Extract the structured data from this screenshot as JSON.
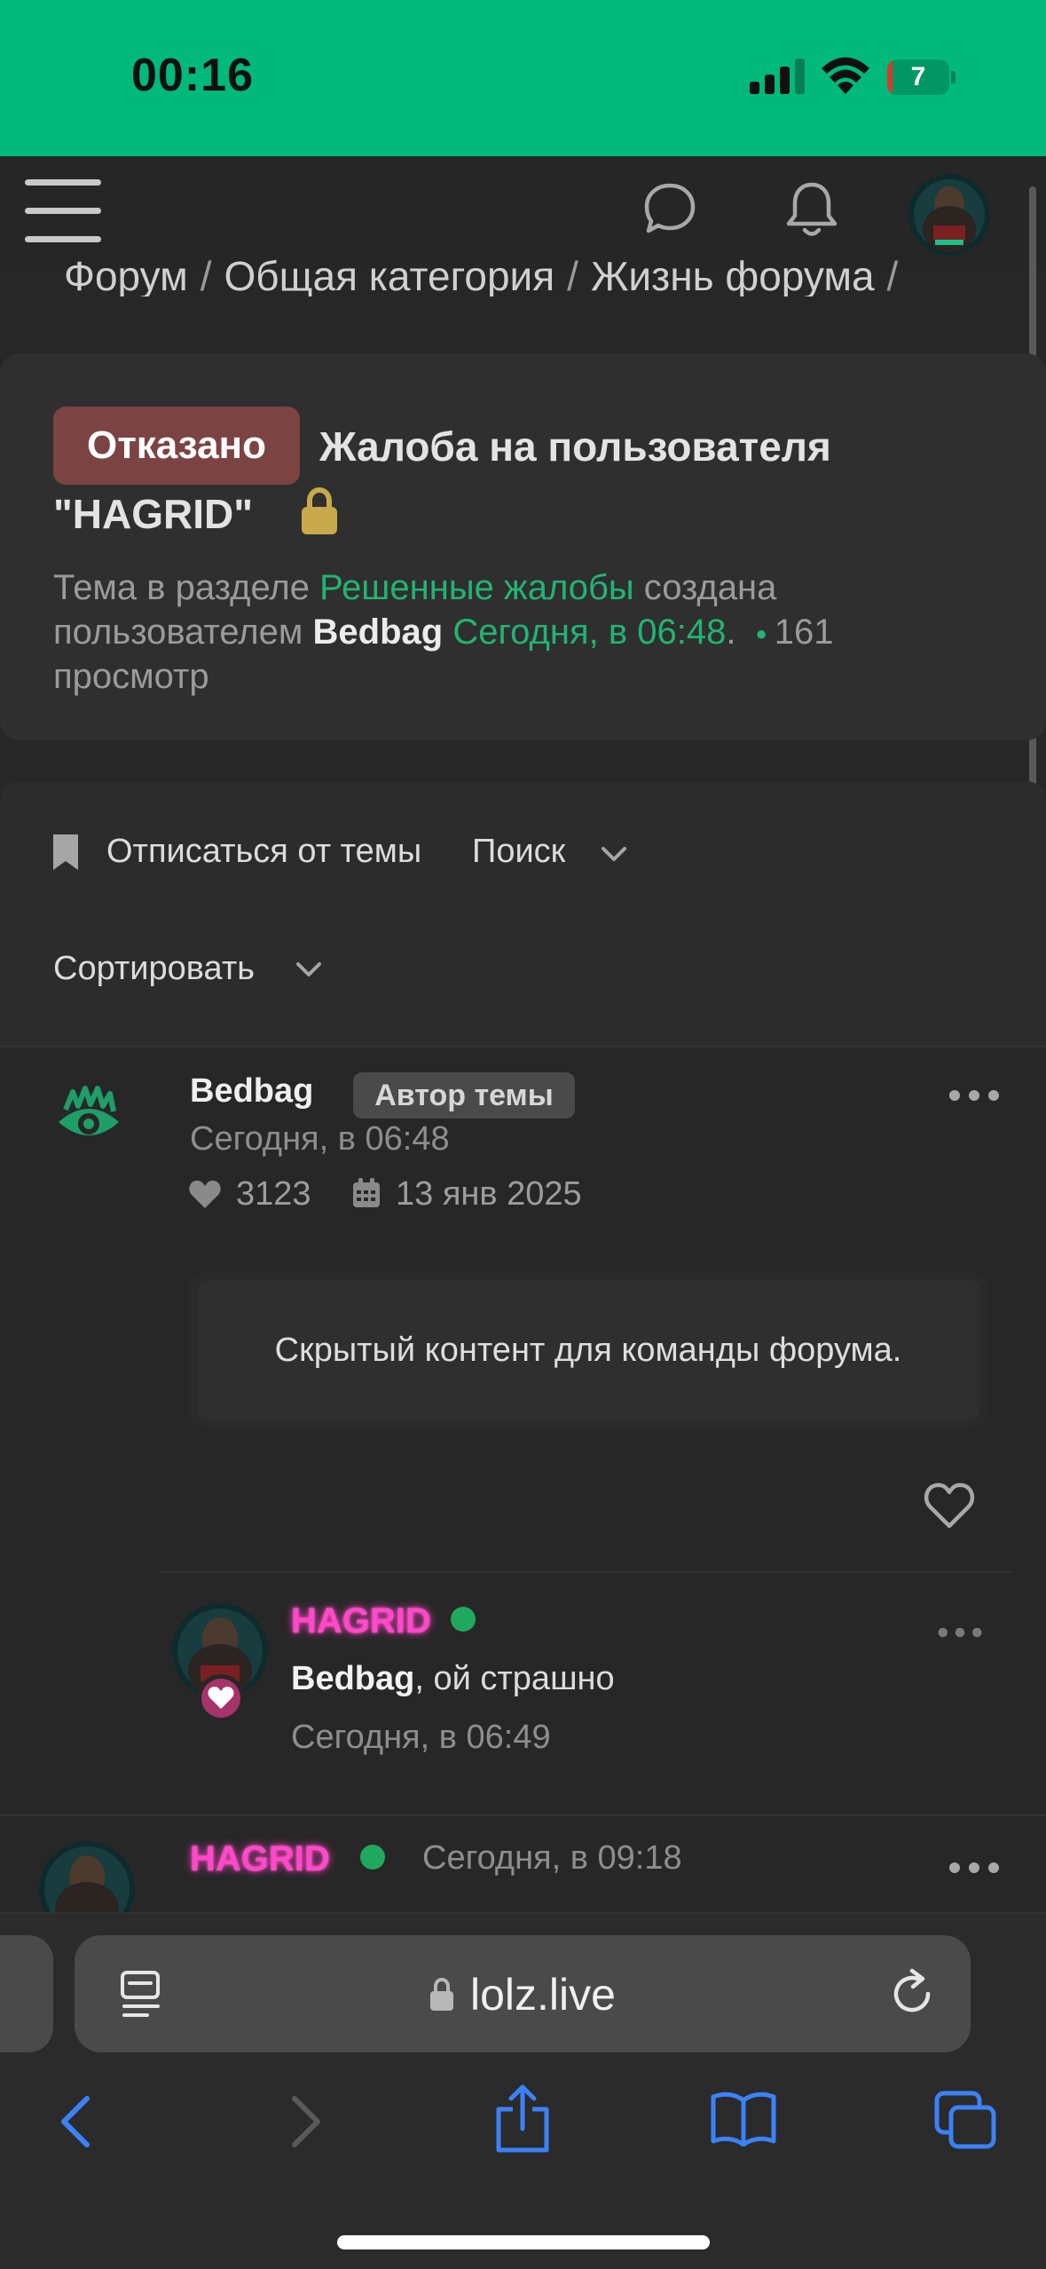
{
  "status_bar": {
    "time": "00:16",
    "battery_level": "7",
    "battery_fraction": 0.07
  },
  "nav": {
    "menu_icon": "hamburger-menu-icon",
    "chat_icon": "chat-bubble-icon",
    "bell_icon": "notification-bell-icon",
    "avatar": "user-avatar"
  },
  "breadcrumb": [
    "Форум",
    "Общая категория",
    "Жизнь форума"
  ],
  "thread": {
    "status_badge": "Отказано",
    "title_line1": "Жалоба на пользователя",
    "title_line2": "\"HAGRID\"",
    "lock_icon": "lock-icon",
    "meta": {
      "prefix": "Тема в разделе",
      "section": "Решенные жалобы",
      "created": "создана",
      "by": "пользователем",
      "author": "Bedbag",
      "date": "Сегодня, в 06:48",
      "period": ".",
      "views": "161",
      "views_label": "просмотр"
    }
  },
  "controls": {
    "unsubscribe": "Отписаться от темы",
    "search": "Поиск",
    "sort": "Сортировать"
  },
  "posts": [
    {
      "author": "Bedbag",
      "badge": "Автор темы",
      "time": "Сегодня, в 06:48",
      "likes": "3123",
      "registered": "13 янв 2025",
      "content": "Скрытый контент для команды форума."
    },
    {
      "author": "HAGRID",
      "time": "Сегодня, в 09:18"
    }
  ],
  "comment": {
    "author": "HAGRID",
    "reply_to": "Bedbag",
    "text": ", ой страшно",
    "time": "Сегодня, в 06:49"
  },
  "browser": {
    "url": "lolz.live"
  },
  "colors": {
    "status_bar": "#00b97a",
    "accent_green": "#22b473",
    "badge_rejected": "#7b4443",
    "neon_pink": "#ff49c8",
    "online": "#1fa95c",
    "ios_blue": "#3b82f6"
  }
}
